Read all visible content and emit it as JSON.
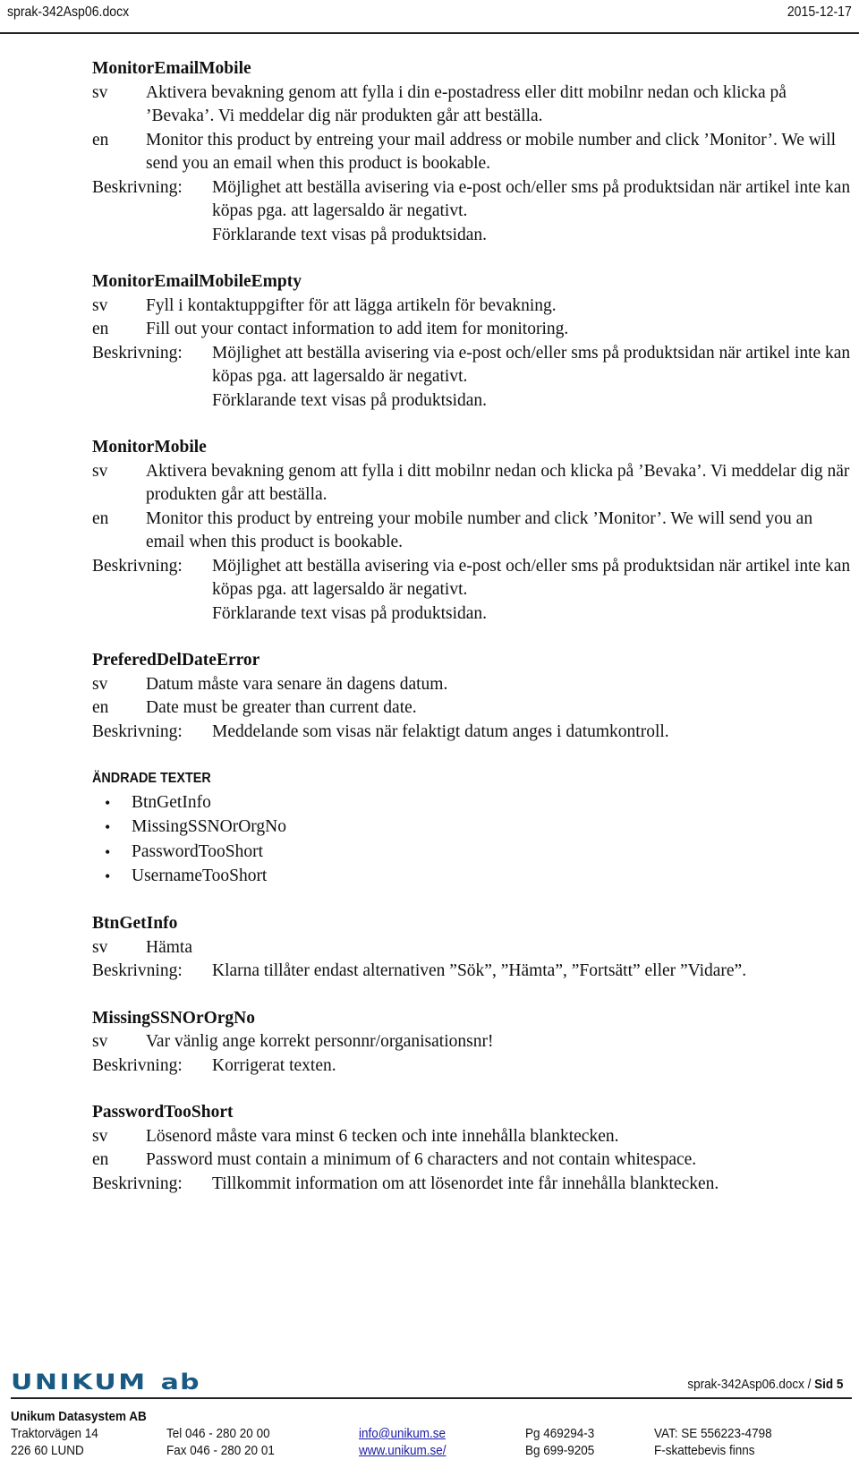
{
  "header": {
    "filename": "sprak-342Asp06.docx",
    "date": "2015-12-17"
  },
  "labels": {
    "sv": "sv",
    "en": "en",
    "desc": "Beskrivning:"
  },
  "entries": [
    {
      "title": "MonitorEmailMobile",
      "sv": "Aktivera bevakning genom att fylla i din e-postadress eller ditt mobilnr nedan och klicka på ’Bevaka’. Vi meddelar dig när produkten går att beställa.",
      "en": "Monitor this product by entreing your mail address or mobile number and click ’Monitor’. We will send you an email when this product is bookable.",
      "desc": "Möjlighet att beställa avisering via e-post och/eller sms på produktsidan när artikel inte kan köpas pga. att lagersaldo är negativt.",
      "desc2": "Förklarande text visas på produktsidan."
    },
    {
      "title": "MonitorEmailMobileEmpty",
      "sv": "Fyll i kontaktuppgifter för att lägga artikeln för bevakning.",
      "en": "Fill out your contact information to add item for monitoring.",
      "desc": "Möjlighet att beställa avisering via e-post och/eller sms på produktsidan när artikel inte kan köpas pga. att lagersaldo är negativt.",
      "desc2": "Förklarande text visas på produktsidan."
    },
    {
      "title": "MonitorMobile",
      "sv": "Aktivera bevakning genom att fylla i ditt mobilnr nedan och klicka på ’Bevaka’. Vi meddelar dig när produkten går att beställa.",
      "en": "Monitor this product by entreing your mobile number and click ’Monitor’. We will send you an email when this product is bookable.",
      "desc": "Möjlighet att beställa avisering via e-post och/eller sms på produktsidan när artikel inte kan köpas pga. att lagersaldo är negativt.",
      "desc2": "Förklarande text visas på produktsidan."
    },
    {
      "title": "PreferedDelDateError",
      "sv": "Datum måste vara senare än dagens datum.",
      "en": "Date must be greater than current date.",
      "desc": "Meddelande som visas när felaktigt datum anges i datumkontroll."
    }
  ],
  "changed_section": {
    "heading": "ÄNDRADE TEXTER",
    "bullet_glyph": "•",
    "items": [
      "BtnGetInfo",
      "MissingSSNOrOrgNo",
      "PasswordTooShort",
      "UsernameTooShort"
    ]
  },
  "changed_entries": [
    {
      "title": "BtnGetInfo",
      "sv": "Hämta",
      "desc": "Klarna tillåter endast alternativen ”Sök”, ”Hämta”, ”Fortsätt” eller ”Vidare”."
    },
    {
      "title": "MissingSSNOrOrgNo",
      "sv": "Var vänlig ange korrekt personnr/organisationsnr!",
      "desc": "Korrigerat texten."
    },
    {
      "title": "PasswordTooShort",
      "sv": "Lösenord måste vara minst 6 tecken och inte innehålla blanktecken.",
      "en": "Password must contain a minimum of 6 characters and not contain whitespace.",
      "desc": "Tillkommit information om att lösenordet inte får innehålla blanktecken."
    }
  ],
  "footer": {
    "logo_main": "UNIKUM",
    "logo_suffix": "ab",
    "logo_color": "#1a5a82",
    "page_ref_file": "sprak-342Asp06.docx / ",
    "page_ref_page": "Sid 5",
    "company": "Unikum Datasystem AB",
    "address1": "Traktorvägen 14",
    "address2": "226 60  LUND",
    "tel": "Tel  046 - 280 20 00",
    "fax": "Fax  046 - 280 20 01",
    "email": "info@unikum.se",
    "web": "www.unikum.se/",
    "pg": "Pg  469294-3",
    "bg": "Bg  699-9205",
    "vat": "VAT: SE 556223-4798",
    "tax": "F-skattebevis finns"
  }
}
